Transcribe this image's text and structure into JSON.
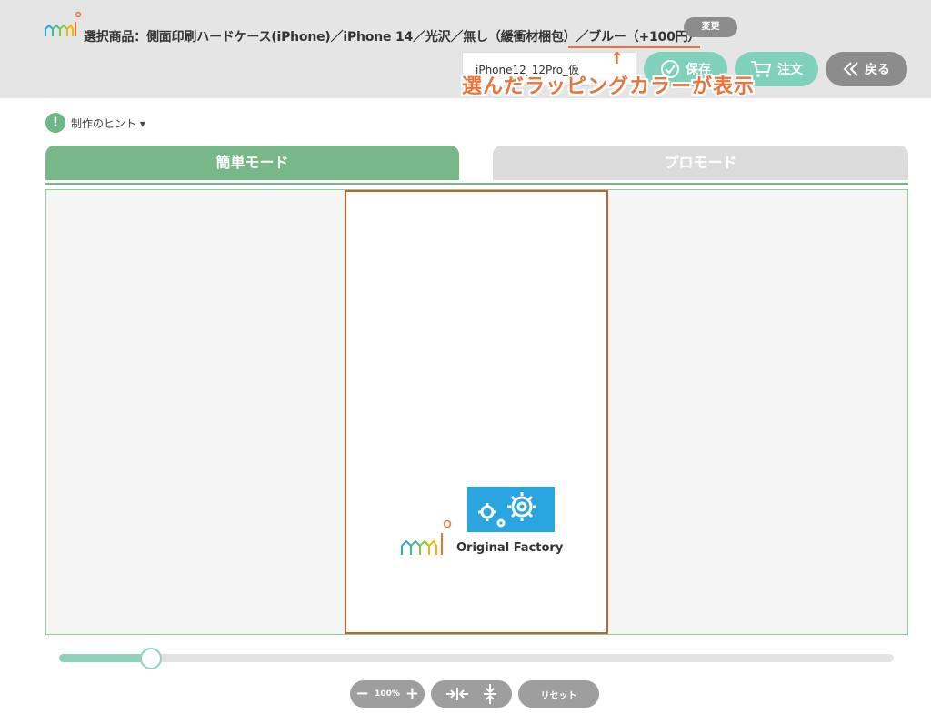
{
  "header": {
    "product_prefix": "選択商品：側面印刷ハードケース(iPhone)／iPhone 14／光沢／無し（緩衝材梱包）",
    "product_color": "／ブルー（+100円）",
    "change_label": "変更",
    "design_name": "iPhone12_12Pro_仮",
    "save_label": "保存",
    "order_label": "注文",
    "back_label": "戻る"
  },
  "annotation": {
    "arrow": "↑",
    "text": "選んだラッピングカラーが表示"
  },
  "hint": {
    "icon": "!",
    "label": "制作のヒント ▾"
  },
  "tabs": [
    {
      "label": "簡単モード",
      "active": true
    },
    {
      "label": "プロモード",
      "active": false
    }
  ],
  "canvas": {
    "logo_text": "Original Factory"
  },
  "zoom": {
    "minus": "−",
    "value": "100%",
    "plus": "+",
    "slider_fraction": 0.11
  },
  "reset_label": "リセット",
  "colors": {
    "accent_green": "#78b787",
    "mint": "#7fd1bb",
    "annotation_orange": "#e8743a",
    "print_border": "#c4622d",
    "gear_blue": "#2aa5e0"
  },
  "icons": [
    "logo-icon",
    "check-icon",
    "cart-icon",
    "double-chevron-left-icon",
    "hint-icon",
    "gear-icon",
    "fit-horizontal-icon",
    "fit-vertical-icon"
  ]
}
